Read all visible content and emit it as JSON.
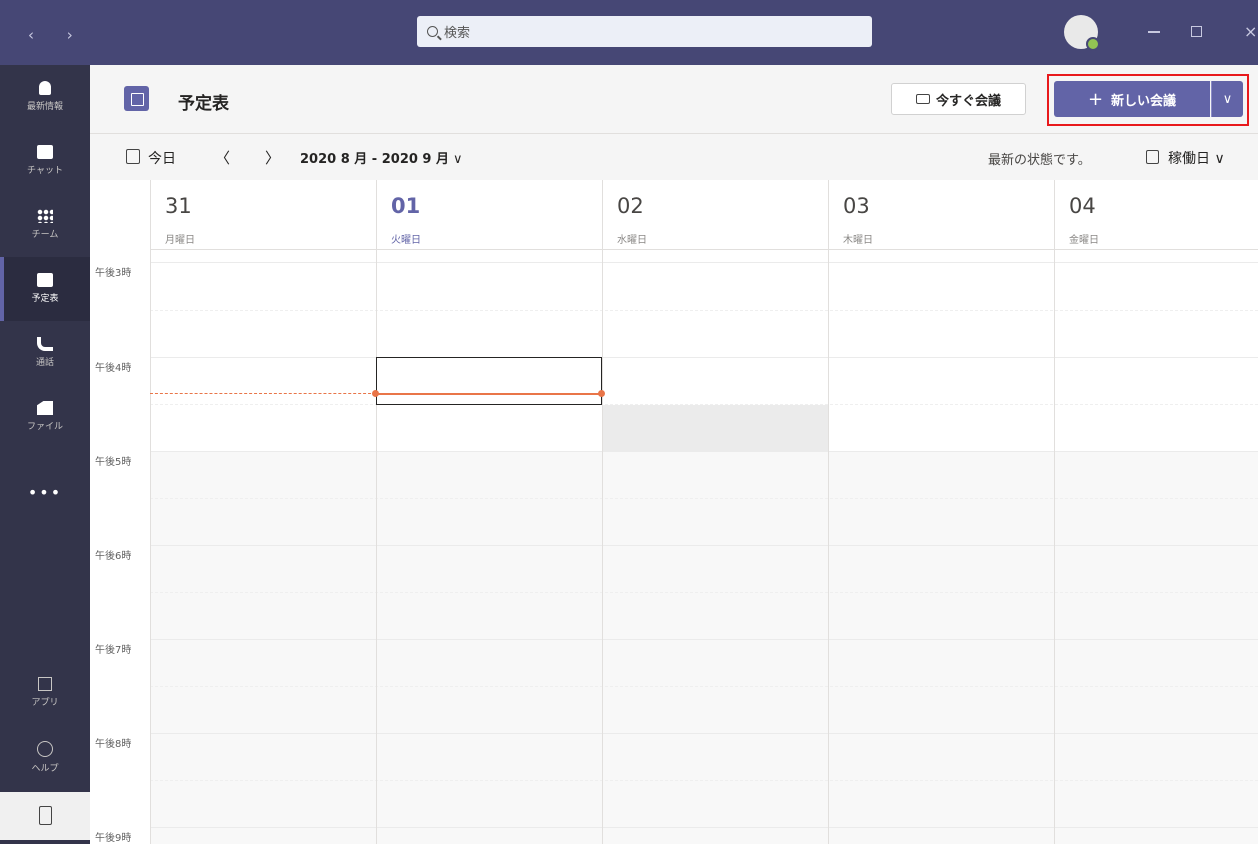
{
  "titlebar": {
    "nav_arrows": "‹ ›",
    "search_placeholder": "検索",
    "close_glyph": "×"
  },
  "rail": {
    "items": [
      {
        "label": "最新情報",
        "icon": "bell-icon"
      },
      {
        "label": "チャット",
        "icon": "chat-icon"
      },
      {
        "label": "チーム",
        "icon": "teams-icon"
      },
      {
        "label": "予定表",
        "icon": "calendar-icon",
        "active": true
      },
      {
        "label": "通話",
        "icon": "phone-icon"
      },
      {
        "label": "ファイル",
        "icon": "file-icon"
      }
    ],
    "more": "•••",
    "apps_label": "アプリ",
    "help_label": "ヘルプ"
  },
  "header": {
    "title": "予定表",
    "meet_now": "今すぐ会議",
    "new_meeting": "新しい会議",
    "new_meeting_plus": "+",
    "dropdown": "∨"
  },
  "toolbar": {
    "today": "今日",
    "prev": "〈",
    "next": "〉",
    "range": "2020 8 月 - 2020 9 月",
    "range_chevron": "∨",
    "status": "最新の状態です。",
    "view": "稼働日 ∨"
  },
  "days": [
    {
      "num": "31",
      "name": "月曜日"
    },
    {
      "num": "01",
      "name": "火曜日",
      "today": true
    },
    {
      "num": "02",
      "name": "水曜日"
    },
    {
      "num": "03",
      "name": "木曜日"
    },
    {
      "num": "04",
      "name": "金曜日"
    }
  ],
  "hours": [
    "午後3時",
    "午後4時",
    "午後5時",
    "午後6時",
    "午後7時",
    "午後8時",
    "午後9時"
  ],
  "colors": {
    "titlebar": "#464775",
    "rail": "#33344a",
    "accent": "#6264a7",
    "now_line": "#e97548",
    "highlight_outline": "#e8191c"
  }
}
